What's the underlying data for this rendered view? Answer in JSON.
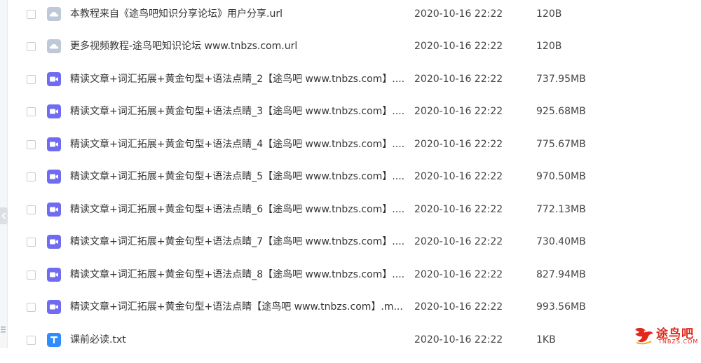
{
  "files": [
    {
      "icon": "url-file-icon",
      "name": "本教程来自《途鸟吧知识分享论坛》用户分享.url",
      "date": "2020-10-16 22:22",
      "size": "120B"
    },
    {
      "icon": "url-file-icon",
      "name": "更多视频教程-途鸟吧知识论坛 www.tnbzs.com.url",
      "date": "2020-10-16 22:22",
      "size": "120B"
    },
    {
      "icon": "video-file-icon",
      "name": "精读文章+词汇拓展+黄金句型+语法点睛_2【途鸟吧 www.tnbzs.com】....",
      "date": "2020-10-16 22:22",
      "size": "737.95MB"
    },
    {
      "icon": "video-file-icon",
      "name": "精读文章+词汇拓展+黄金句型+语法点睛_3【途鸟吧 www.tnbzs.com】....",
      "date": "2020-10-16 22:22",
      "size": "925.68MB"
    },
    {
      "icon": "video-file-icon",
      "name": "精读文章+词汇拓展+黄金句型+语法点睛_4【途鸟吧 www.tnbzs.com】....",
      "date": "2020-10-16 22:22",
      "size": "775.67MB"
    },
    {
      "icon": "video-file-icon",
      "name": "精读文章+词汇拓展+黄金句型+语法点睛_5【途鸟吧 www.tnbzs.com】....",
      "date": "2020-10-16 22:22",
      "size": "970.50MB"
    },
    {
      "icon": "video-file-icon",
      "name": "精读文章+词汇拓展+黄金句型+语法点睛_6【途鸟吧 www.tnbzs.com】....",
      "date": "2020-10-16 22:22",
      "size": "772.13MB"
    },
    {
      "icon": "video-file-icon",
      "name": "精读文章+词汇拓展+黄金句型+语法点睛_7【途鸟吧 www.tnbzs.com】....",
      "date": "2020-10-16 22:22",
      "size": "730.40MB"
    },
    {
      "icon": "video-file-icon",
      "name": "精读文章+词汇拓展+黄金句型+语法点睛_8【途鸟吧 www.tnbzs.com】....",
      "date": "2020-10-16 22:22",
      "size": "827.94MB"
    },
    {
      "icon": "video-file-icon",
      "name": "精读文章+词汇拓展+黄金句型+语法点睛【途鸟吧 www.tnbzs.com】.m...",
      "date": "2020-10-16 22:22",
      "size": "993.56MB"
    },
    {
      "icon": "txt-file-icon",
      "name": "课前必读.txt",
      "date": "2020-10-16 22:22",
      "size": "1KB"
    }
  ],
  "colors": {
    "video_icon": "#6f6cf2",
    "url_icon": "#bdc9d8",
    "txt_icon": "#2f8cff",
    "checkbox_border": "#c8ccd3",
    "watermark": "#e2271c"
  },
  "watermark": {
    "name": "途鸟吧",
    "domain": "TNBZS.COM"
  }
}
